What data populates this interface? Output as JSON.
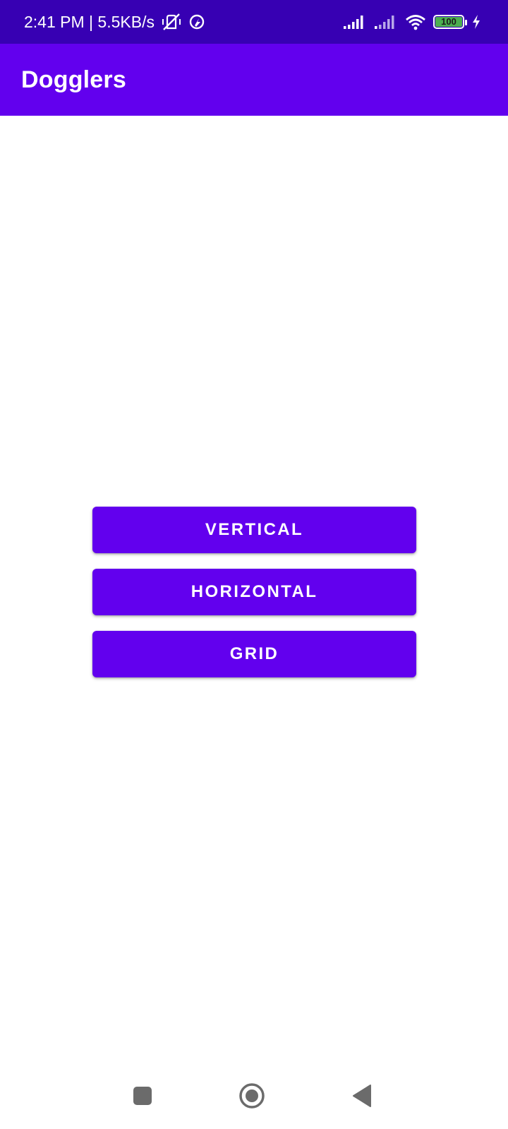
{
  "status_bar": {
    "time_speed": "2:41 PM | 5.5KB/s",
    "battery_level": "100",
    "icons": [
      "vibrate-off-icon",
      "app-notification-icon",
      "signal-icon",
      "signal-secondary-icon",
      "wifi-icon",
      "battery-icon",
      "charging-icon"
    ]
  },
  "app_bar": {
    "title": "Dogglers"
  },
  "buttons": [
    {
      "label": "VERTICAL"
    },
    {
      "label": "HORIZONTAL"
    },
    {
      "label": "GRID"
    }
  ],
  "nav_bar": {
    "icons": [
      "recents-icon",
      "home-icon",
      "back-icon"
    ]
  },
  "colors": {
    "status_bar": "#3700b3",
    "primary": "#6200ee",
    "on_primary": "#ffffff",
    "battery_fill": "#4caf50",
    "nav_icons": "#6b6b6b"
  }
}
